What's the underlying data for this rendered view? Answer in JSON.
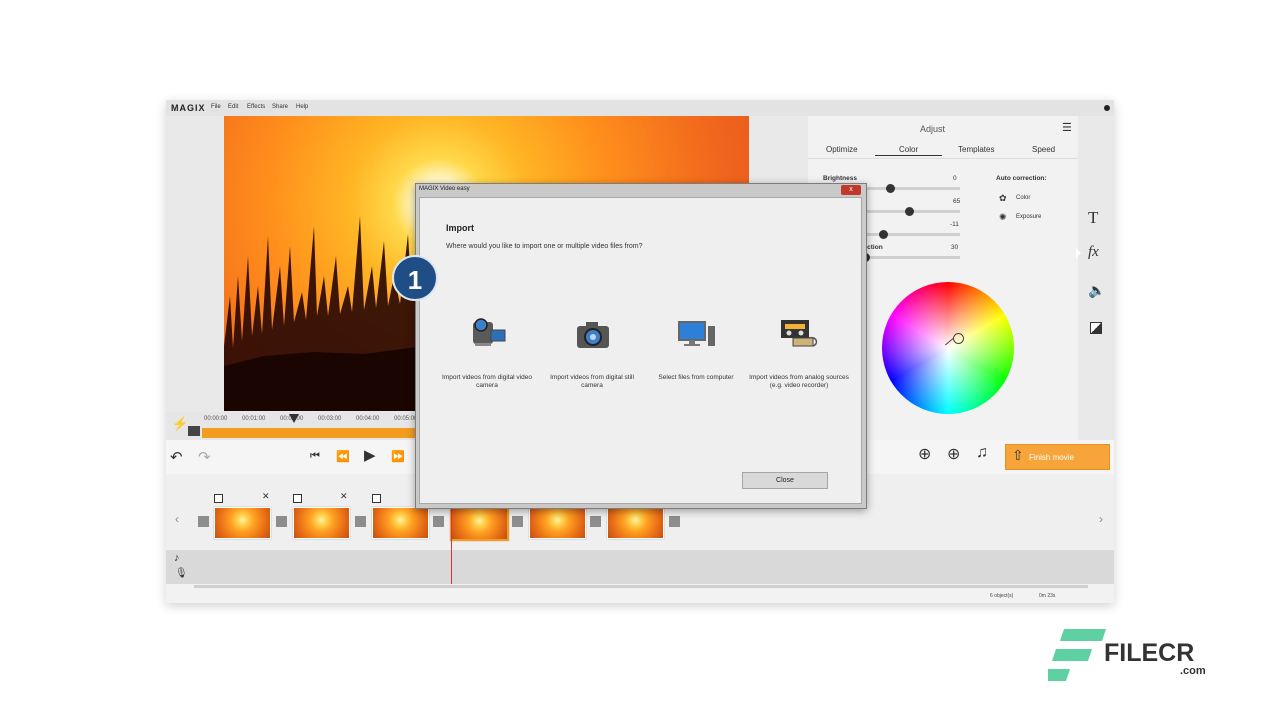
{
  "app": {
    "logo": "MAGIX",
    "menu": [
      "File",
      "Edit",
      "Effects",
      "Share",
      "Help"
    ]
  },
  "timeline": {
    "ticks": [
      "00:00:00",
      "00:01:00",
      "00:02:00",
      "00:03:00",
      "00:04:00",
      "00:05:00"
    ]
  },
  "adjust": {
    "title": "Adjust",
    "tabs": [
      "Optimize",
      "Color",
      "Templates",
      "Speed"
    ],
    "active_tab": "Color",
    "sliders": [
      {
        "label": "Brightness",
        "value": "0",
        "level": 0.5
      },
      {
        "label": "",
        "value": "65",
        "level": 0.8
      },
      {
        "label": "",
        "value": "-11",
        "level": 0.44
      },
      {
        "label": "rection",
        "value": "30",
        "level": 0.0
      }
    ],
    "auto_correction_title": "Auto correction:",
    "auto_color": "Color",
    "auto_exposure": "Exposure"
  },
  "controls": {
    "finish_label": "Finish movie"
  },
  "dialog": {
    "window_title": "MAGIX Video easy",
    "heading": "Import",
    "question": "Where would you like to import one or multiple video files from?",
    "options": [
      {
        "label": "Import videos from digital video camera",
        "icon": "video-camera-icon"
      },
      {
        "label": "Import videos from digital still camera",
        "icon": "photo-camera-icon"
      },
      {
        "label": "Select files from computer",
        "icon": "computer-icon"
      },
      {
        "label": "Import videos from analog sources (e.g. video recorder)",
        "icon": "vcr-tape-icon"
      }
    ],
    "close_label": "Close",
    "close_x": "x"
  },
  "annotation": {
    "badge": "1"
  },
  "status": {
    "objects": "6 object(s)",
    "duration": "0m 23s"
  },
  "watermark": {
    "brand": "FILECR",
    "suffix": ".com"
  },
  "colors": {
    "accent": "#f39c1f",
    "badge": "#1f4e86",
    "watermark": "#5ed0a1"
  }
}
